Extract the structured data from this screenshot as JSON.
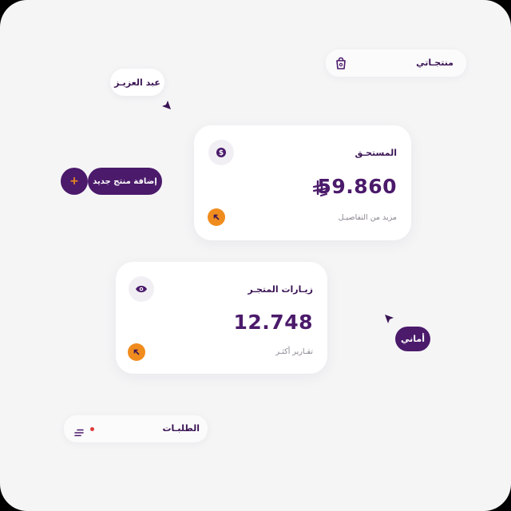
{
  "top_pill": {
    "label": "منتجـاتي",
    "icon": "shopping-bag-icon"
  },
  "user_bubble": {
    "label": "عبد العزيـز"
  },
  "add_product": {
    "label": "إضافة منتج جديد",
    "plus": "+"
  },
  "due_card": {
    "title": "المستحـق",
    "amount": "59.860",
    "currency": "riyal-symbol-icon",
    "more_link": "مزيد من التفاصيـل",
    "icon": "dollar-coin-icon"
  },
  "visits_card": {
    "title": "زيـارات المتجـر",
    "amount": "12.748",
    "more_link": "تقـارير أكثـر",
    "icon": "eye-icon"
  },
  "amani_bubble": {
    "label": "أماني"
  },
  "orders_pill": {
    "label": "الطلبـات",
    "icon": "menu-lines-icon"
  },
  "colors": {
    "accent_purple": "#4b1a6b",
    "accent_orange": "#f08c1e",
    "notification_red": "#e03a3a",
    "background": "#f5f5f6"
  }
}
